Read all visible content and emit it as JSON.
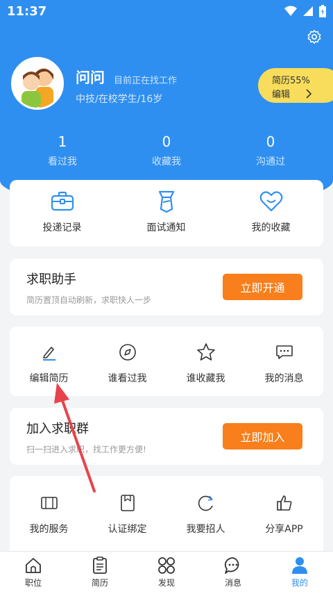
{
  "status_bar": {
    "time": "11:37"
  },
  "profile": {
    "name": "问问",
    "status": "目前正在找工作",
    "info": "中技/在校学生/16岁",
    "resume_pct": "简历55%",
    "resume_edit": "编辑"
  },
  "stats": [
    {
      "num": "1",
      "label": "看过我"
    },
    {
      "num": "0",
      "label": "收藏我"
    },
    {
      "num": "0",
      "label": "沟通过"
    }
  ],
  "quick_actions": [
    {
      "label": "投递记录"
    },
    {
      "label": "面试通知"
    },
    {
      "label": "我的收藏"
    }
  ],
  "job_assistant": {
    "title": "求职助手",
    "subtitle": "简历置顶自动刷新，求职快人一步",
    "button": "立即开通"
  },
  "resume_tools": [
    {
      "label": "编辑简历"
    },
    {
      "label": "谁看过我"
    },
    {
      "label": "谁收藏我"
    },
    {
      "label": "我的消息"
    }
  ],
  "join_group": {
    "title": "加入求职群",
    "subtitle": "扫一扫进入求职，找工作更方便!",
    "button": "立即加入"
  },
  "services": [
    {
      "label": "我的服务"
    },
    {
      "label": "认证绑定"
    },
    {
      "label": "我要招人"
    },
    {
      "label": "分享APP"
    }
  ],
  "bottom_nav": [
    {
      "label": "职位"
    },
    {
      "label": "简历"
    },
    {
      "label": "发现"
    },
    {
      "label": "消息"
    },
    {
      "label": "我的"
    }
  ],
  "colors": {
    "primary": "#2f8ff0",
    "orange": "#f87f1b",
    "pill": "#f7dd5b",
    "arrow": "#e8434a"
  }
}
